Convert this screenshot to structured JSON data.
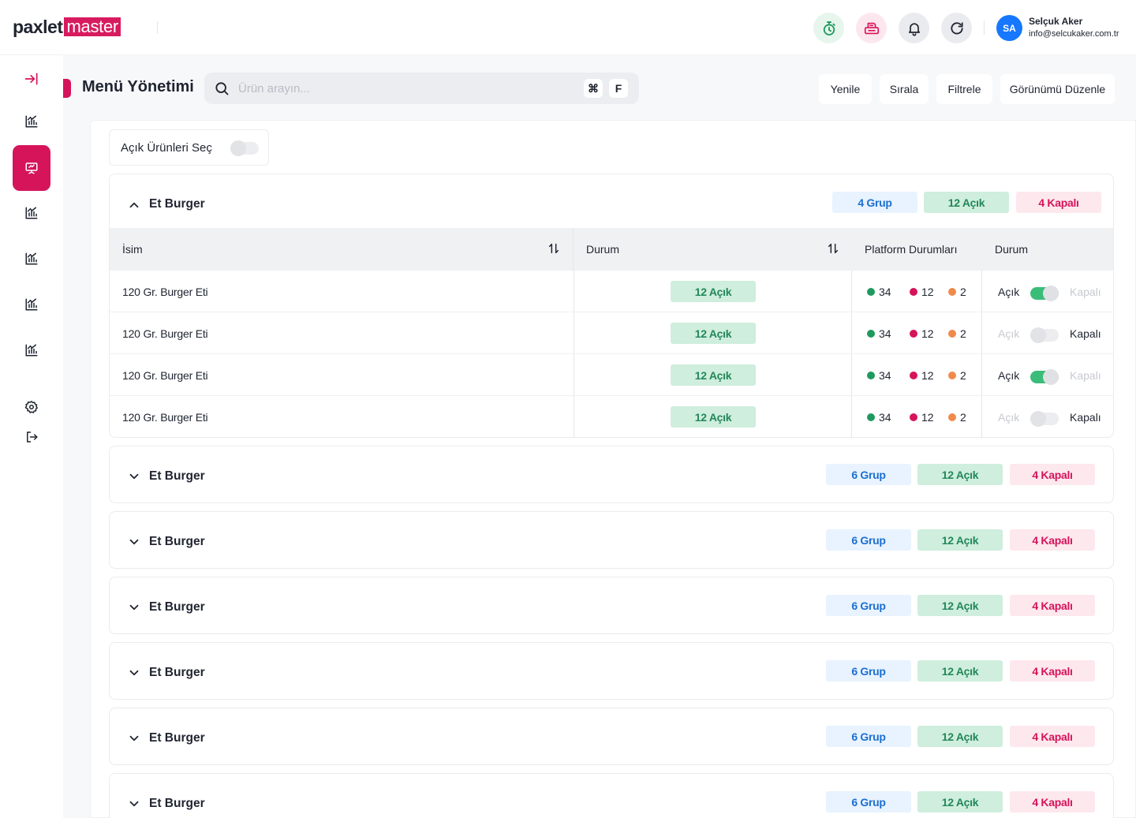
{
  "brand": {
    "part1": "pa",
    "mark": "x",
    "part2": "let",
    "part3": "master"
  },
  "header": {
    "icons": [
      "stopwatch-icon",
      "printer-icon",
      "bell-icon",
      "refresh-icon"
    ],
    "user": {
      "initials": "SA",
      "name": "Selçuk Aker",
      "email": "info@selcukaker.com.tr"
    }
  },
  "colors": {
    "accent": "#d6145a",
    "green": "#23875a",
    "blue": "#1b6fd1",
    "red_dot": "#d6145a",
    "green_dot": "#1f9a5f",
    "orange_dot": "#f08a4b"
  },
  "sidebar": {
    "items": [
      {
        "icon": "collapse-icon"
      },
      {
        "icon": "chart-icon"
      },
      {
        "icon": "presentation-icon",
        "active": true
      },
      {
        "icon": "chart-icon"
      },
      {
        "icon": "chart-icon"
      },
      {
        "icon": "chart-icon"
      },
      {
        "icon": "chart-icon"
      },
      {
        "icon": "gear-icon"
      },
      {
        "icon": "logout-icon"
      }
    ]
  },
  "page": {
    "title": "Menü Yönetimi"
  },
  "search": {
    "placeholder": "Ürün arayın...",
    "value": "",
    "shortcut_symbol": "⌘",
    "shortcut_key": "F"
  },
  "toolbar": {
    "refresh": "Yenile",
    "sort": "Sırala",
    "filter": "Filtrele",
    "edit_view": "Görünümü Düzenle"
  },
  "open_select": {
    "label": "Açık Ürünleri Seç",
    "checked": false
  },
  "groups": [
    {
      "title": "Et Burger",
      "expanded": true,
      "badges": {
        "groups": "4 Grup",
        "open": "12 Açık",
        "closed": "4 Kapalı"
      },
      "columns": {
        "name": "İsim",
        "status": "Durum",
        "platforms": "Platform Durumları",
        "state": "Durum"
      },
      "rows": [
        {
          "name": "120 Gr. Burger Eti",
          "status": "12 Açık",
          "green": "34",
          "red": "12",
          "orange": "2",
          "open_label": "Açık",
          "closed_label": "Kapalı",
          "is_open": true
        },
        {
          "name": "120 Gr. Burger Eti",
          "status": "12 Açık",
          "green": "34",
          "red": "12",
          "orange": "2",
          "open_label": "Açık",
          "closed_label": "Kapalı",
          "is_open": false
        },
        {
          "name": "120 Gr. Burger Eti",
          "status": "12 Açık",
          "green": "34",
          "red": "12",
          "orange": "2",
          "open_label": "Açık",
          "closed_label": "Kapalı",
          "is_open": true
        },
        {
          "name": "120 Gr. Burger Eti",
          "status": "12 Açık",
          "green": "34",
          "red": "12",
          "orange": "2",
          "open_label": "Açık",
          "closed_label": "Kapalı",
          "is_open": false
        }
      ]
    },
    {
      "title": "Et Burger",
      "expanded": false,
      "badges": {
        "groups": "6 Grup",
        "open": "12 Açık",
        "closed": "4 Kapalı"
      }
    },
    {
      "title": "Et Burger",
      "expanded": false,
      "badges": {
        "groups": "6 Grup",
        "open": "12 Açık",
        "closed": "4 Kapalı"
      }
    },
    {
      "title": "Et Burger",
      "expanded": false,
      "badges": {
        "groups": "6 Grup",
        "open": "12 Açık",
        "closed": "4 Kapalı"
      }
    },
    {
      "title": "Et Burger",
      "expanded": false,
      "badges": {
        "groups": "6 Grup",
        "open": "12 Açık",
        "closed": "4 Kapalı"
      }
    },
    {
      "title": "Et Burger",
      "expanded": false,
      "badges": {
        "groups": "6 Grup",
        "open": "12 Açık",
        "closed": "4 Kapalı"
      }
    },
    {
      "title": "Et Burger",
      "expanded": false,
      "badges": {
        "groups": "6 Grup",
        "open": "12 Açık",
        "closed": "4 Kapalı"
      }
    }
  ]
}
